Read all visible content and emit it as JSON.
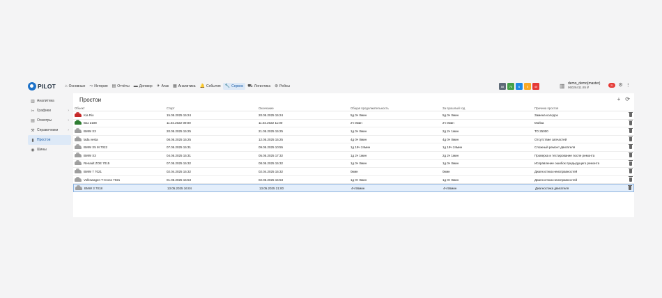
{
  "logo": {
    "text": "PILOT"
  },
  "nav": [
    {
      "label": "Основные",
      "icon": "home-icon",
      "glyph": "⌂"
    },
    {
      "label": "История",
      "icon": "history-icon",
      "glyph": "⤳"
    },
    {
      "label": "Отчёты",
      "icon": "reports-icon",
      "glyph": "▤"
    },
    {
      "label": "Договор",
      "icon": "contract-icon",
      "glyph": "▬"
    },
    {
      "label": "Атак",
      "icon": "attack-icon",
      "glyph": "✈"
    },
    {
      "label": "Аналитика",
      "icon": "analytics-icon",
      "glyph": "▦"
    },
    {
      "label": "События",
      "icon": "bell-icon",
      "glyph": "🔔"
    },
    {
      "label": "Сервис",
      "icon": "wrench-icon",
      "glyph": "🔧",
      "active": true
    },
    {
      "label": "Логистика",
      "icon": "truck-icon",
      "glyph": "⛟"
    },
    {
      "label": "Рейсы",
      "icon": "flights-icon",
      "glyph": "⊛"
    }
  ],
  "status_boxes": [
    {
      "label": "88",
      "color": "#5f6b78"
    },
    {
      "label": "70",
      "color": "#43a047"
    },
    {
      "label": "6",
      "color": "#1e88e5"
    },
    {
      "label": "5",
      "color": "#f9a825"
    },
    {
      "label": "40",
      "color": "#e53935"
    }
  ],
  "user": {
    "name": "demo_demo(master)",
    "balance": "96026411.85 ₽"
  },
  "notifications": {
    "count": "21"
  },
  "sidebar": [
    {
      "label": "Аналитика",
      "icon": "analytics-icon",
      "glyph": "▥"
    },
    {
      "label": "Графики",
      "icon": "charts-icon",
      "glyph": "✂",
      "chevron": true
    },
    {
      "label": "Осмотры",
      "icon": "inspection-icon",
      "glyph": "▤",
      "chevron": true
    },
    {
      "label": "Справочники",
      "icon": "directory-icon",
      "glyph": "⚒",
      "chevron": true
    },
    {
      "label": "Простои",
      "icon": "downtime-icon",
      "glyph": "▮",
      "active": true
    },
    {
      "label": "Шины",
      "icon": "tire-icon",
      "glyph": "◉"
    }
  ],
  "page": {
    "title": "Простои"
  },
  "table": {
    "headers": [
      "Объект",
      "Старт",
      "Окончание",
      "Общая продолжительность",
      "За прошлый год",
      "Причина простоя"
    ],
    "rows": [
      {
        "object": "Kia Rio",
        "car_color": "#c62828",
        "start": "15.05.2025 15:24",
        "end": "20.05.2025 15:24",
        "total": "5д 0ч 0мин",
        "last_year": "5д 0ч 0мин",
        "reason": "Замена колодок"
      },
      {
        "object": "Ваз 2108",
        "car_color": "#2e7d32",
        "start": "11.02.2022 09:00",
        "end": "11.02.2022 11:00",
        "total": "2ч 0мин",
        "last_year": "2ч 0мин",
        "reason": "Мойка"
      },
      {
        "object": "BMW X3",
        "car_color": "#9e9e9e",
        "start": "20.05.2025 15:25",
        "end": "21.05.2025 15:25",
        "total": "1д 0ч 0мин",
        "last_year": "2д 2ч 1мин",
        "reason": "ТО 25000"
      },
      {
        "object": "lada vesta",
        "car_color": "#9e9e9e",
        "start": "08.05.2025 15:25",
        "end": "12.05.2025 15:25",
        "total": "4д 0ч 0мин",
        "last_year": "4д 0ч 0мин",
        "reason": "Отсутствие запчастей"
      },
      {
        "object": "BMW X5 M 7022",
        "car_color": "#9e9e9e",
        "start": "07.05.2025 15:31",
        "end": "09.05.2025 10:55",
        "total": "1д 19ч 24мин",
        "last_year": "1д 19ч 24мин",
        "reason": "Сложный ремонт двигателя"
      },
      {
        "object": "BMW X3",
        "car_color": "#9e9e9e",
        "start": "04.05.2025 15:31",
        "end": "05.05.2025 17:32",
        "total": "1д 2ч 1мин",
        "last_year": "2д 2ч 1мин",
        "reason": "Проверка и тестирование после ремонта"
      },
      {
        "object": "Renault ZOE 7015",
        "car_color": "#9e9e9e",
        "start": "07.05.2025 15:32",
        "end": "08.05.2025 15:32",
        "total": "1д 0ч 0мин",
        "last_year": "1д 0ч 0мин",
        "reason": "Исправление ошибок предыдущего ремонта"
      },
      {
        "object": "BMW 7 7021",
        "car_color": "#9e9e9e",
        "start": "02.04.2025 15:32",
        "end": "02.04.2025 15:32",
        "total": "0мин",
        "last_year": "0мин",
        "reason": "Диагностика неисправностей"
      },
      {
        "object": "Volkswagen T-Cross 7021",
        "car_color": "#9e9e9e",
        "start": "01.05.2025 15:53",
        "end": "02.05.2025 15:53",
        "total": "1д 0ч 0мин",
        "last_year": "1д 0ч 0мин",
        "reason": "Диагностика неисправностей"
      },
      {
        "object": "BMW 3 7018",
        "car_color": "#9e9e9e",
        "start": "13.05.2025 16:04",
        "end": "13.05.2025 21:00",
        "total": "4ч 56мин",
        "last_year": "4ч 56мин",
        "reason": "Диагностика двигателя",
        "selected": true
      }
    ]
  }
}
